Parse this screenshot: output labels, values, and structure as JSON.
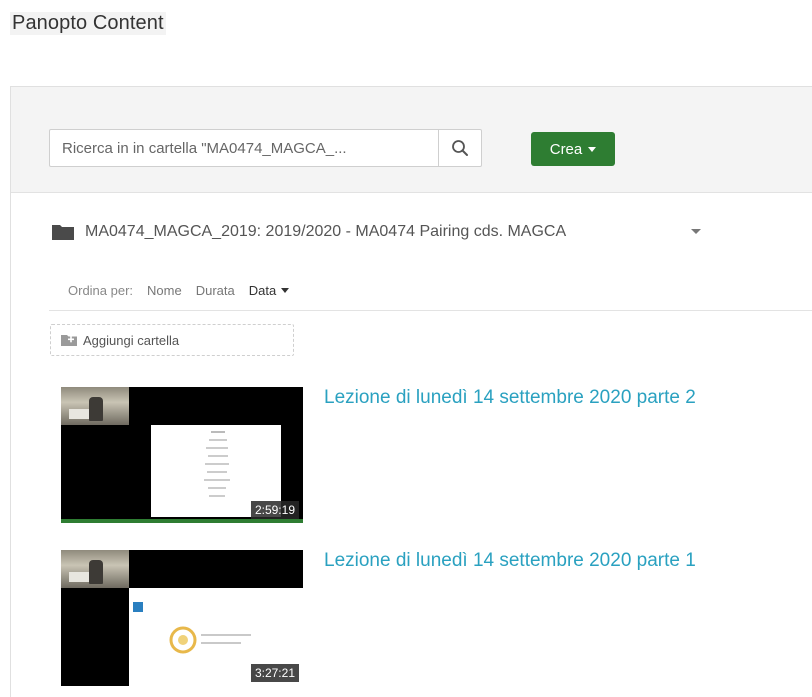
{
  "page": {
    "title": "Panopto Content"
  },
  "search": {
    "placeholder": "Ricerca in in cartella \"MA0474_MAGCA_..."
  },
  "toolbar": {
    "create_label": "Crea"
  },
  "folder": {
    "name": "MA0474_MAGCA_2019: 2019/2020 - MA0474 Pairing cds. MAGCA"
  },
  "sort": {
    "label": "Ordina per:",
    "options": [
      "Nome",
      "Durata",
      "Data"
    ],
    "active": "Data"
  },
  "add_folder": {
    "label": "Aggiungi cartella"
  },
  "sessions": [
    {
      "title": "Lezione di lunedì 14 settembre 2020 parte 2",
      "duration": "2:59:19"
    },
    {
      "title": "Lezione di lunedì 14 settembre 2020 parte 1",
      "duration": "3:27:21"
    }
  ],
  "colors": {
    "accent": "#2e7d32",
    "link": "#2aa1c0"
  }
}
